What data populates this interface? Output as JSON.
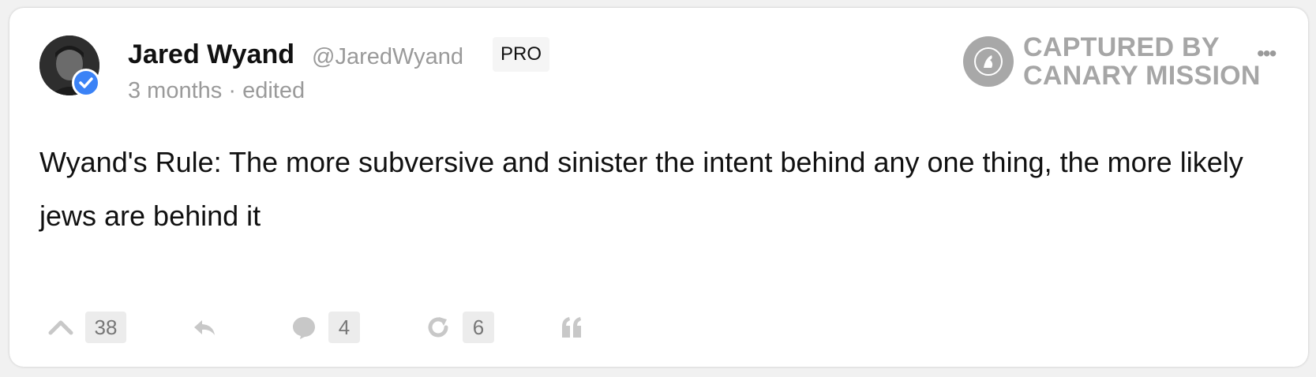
{
  "post": {
    "author_name": "Jared Wyand",
    "handle": "@JaredWyand",
    "badge": "PRO",
    "time": "3 months",
    "separator": "·",
    "edited": "edited",
    "text": "Wyand's Rule: The more subversive and sinister the intent behind any one thing, the more likely jews are behind it"
  },
  "watermark": {
    "line1": "CAPTURED BY",
    "line2": "CANARY MISSION"
  },
  "actions": {
    "upvote_count": "38",
    "comment_count": "4",
    "repost_count": "6"
  },
  "colors": {
    "verified": "#3b82f6",
    "muted": "#9a9a9a",
    "icon": "#c8c8c8"
  },
  "icons": [
    "upvote-icon",
    "reply-icon",
    "comment-icon",
    "repost-icon",
    "quote-icon",
    "more-icon",
    "verified-check-icon"
  ]
}
